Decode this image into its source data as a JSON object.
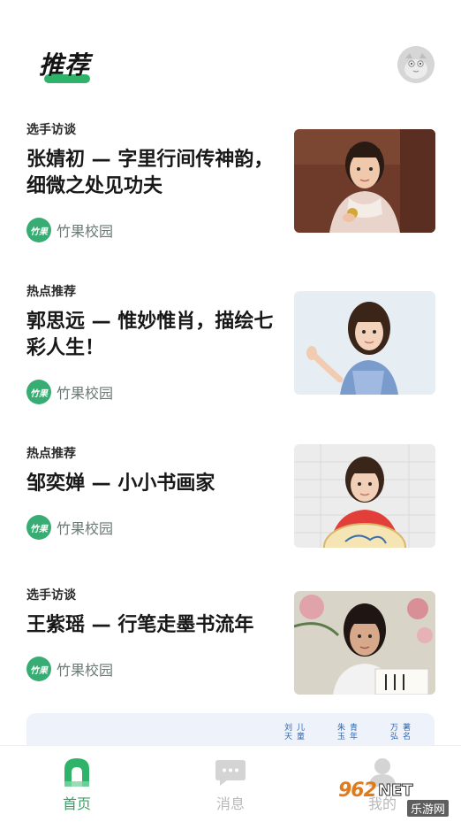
{
  "header": {
    "title": "推荐",
    "accent_color": "#2fb36a"
  },
  "feed": [
    {
      "category": "选手访谈",
      "title": "张婧初 — 字里行间传神韵，细微之处见功夫",
      "source": "竹果校园",
      "source_logo_text": "竹果"
    },
    {
      "category": "热点推荐",
      "title": "郭思远 — 惟妙惟肖，描绘七彩人生！",
      "source": "竹果校园",
      "source_logo_text": "竹果"
    },
    {
      "category": "热点推荐",
      "title": "邹奕婵 — 小小书画家",
      "source": "竹果校园",
      "source_logo_text": "竹果"
    },
    {
      "category": "选手访谈",
      "title": "王紫瑶 — 行笔走墨书流年",
      "source": "竹果校园",
      "source_logo_text": "竹果"
    }
  ],
  "banner": {
    "columns": [
      "刘天",
      "儿童",
      "朱玉",
      "青年",
      "万弘",
      "著名"
    ]
  },
  "tabbar": {
    "tabs": [
      {
        "label": "首页",
        "icon": "home-icon",
        "active": true
      },
      {
        "label": "消息",
        "icon": "message-icon",
        "active": false
      },
      {
        "label": "我的",
        "icon": "profile-icon",
        "active": false
      }
    ],
    "active_color": "#3a9e66",
    "inactive_color": "#b8b8b8"
  },
  "watermark": {
    "brand_number": "962",
    "brand_suffix": "NET",
    "subtitle": "乐游网"
  }
}
